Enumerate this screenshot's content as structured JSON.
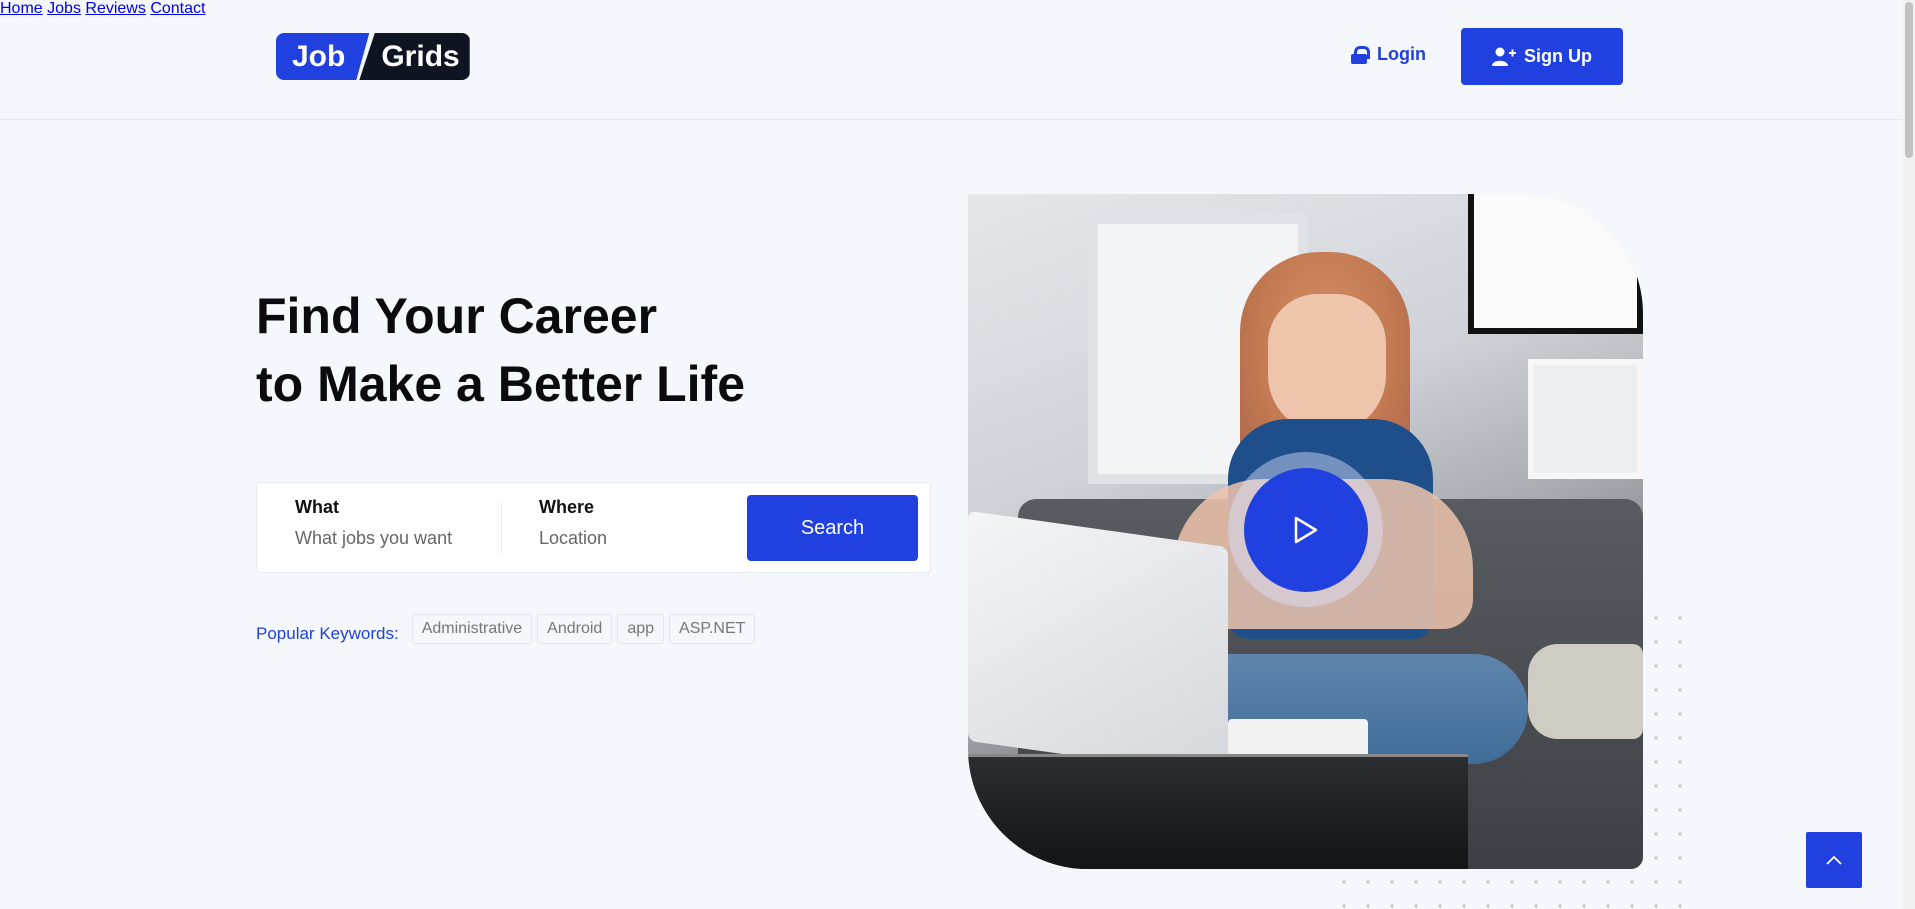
{
  "brand": {
    "part1": "Job",
    "part2": "Grids"
  },
  "nav": {
    "items": [
      {
        "label": "Home"
      },
      {
        "label": "Jobs"
      },
      {
        "label": "Reviews"
      },
      {
        "label": "Contact"
      }
    ],
    "login_label": "Login",
    "signup_label": "Sign Up"
  },
  "hero": {
    "title_line1": "Find Your Career",
    "title_line2": "to Make a Better Life"
  },
  "search": {
    "what_label": "What",
    "what_placeholder": "What jobs you want",
    "where_label": "Where",
    "where_placeholder": "Location",
    "button_label": "Search"
  },
  "keywords": {
    "label": "Popular Keywords:",
    "items": [
      "Administrative",
      "Android",
      "app",
      "ASP.NET"
    ]
  },
  "icons": {
    "lock": "lock-icon",
    "user_plus": "user-plus-icon",
    "play": "play-icon",
    "chevron_up": "chevron-up-icon"
  },
  "colors": {
    "accent": "#2140e0",
    "dark": "#0f1423",
    "background": "#f4f7fb"
  }
}
